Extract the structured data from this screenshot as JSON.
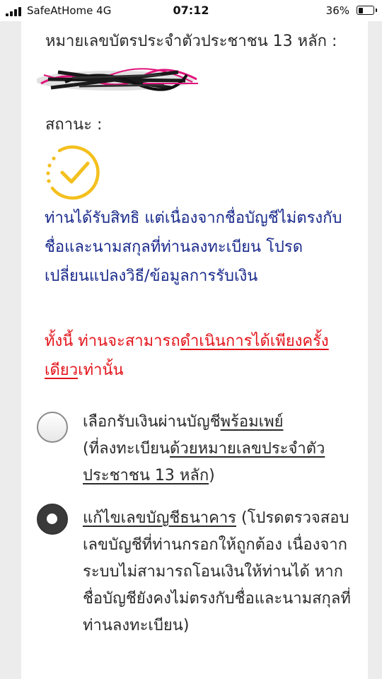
{
  "status_bar": {
    "carrier": "SafeAtHome  4G",
    "time": "07:12",
    "battery_percent_label": "36%",
    "battery_level": 0.36
  },
  "id_field": {
    "label": "หมายเลขบัตรประจำตัวประชาชน 13 หลัก :"
  },
  "status": {
    "label": "สถานะ :",
    "icon": "check-circle-icon",
    "icon_color": "#f4c01e"
  },
  "message": {
    "blue_text": "ท่านได้รับสิทธิ แต่เนื่องจากชื่อบัญชีไม่ตรงกับชื่อและนามสกุลที่ท่านลงทะเบียน โปรดเปลี่ยนแปลงวิธี/ข้อมูลการรับเงิน",
    "blue_color": "#1a2a8c",
    "red_prefix": "ทั้งนี้ ท่านจะสามารถ",
    "red_underlined": "ดำเนินการได้เพียงครั้งเดียว",
    "red_suffix": "เท่านั้น",
    "red_color": "#e3141b"
  },
  "options": [
    {
      "selected": false,
      "part1": "เลือกรับเงินผ่านบัญชี",
      "part1_u": "พร้อมเพย์",
      "part2": "(ที่ลงทะเบียน",
      "part2_u": "ด้วยหมายเลขประจำตัวประชาชน 13 หลัก",
      "part3": ")"
    },
    {
      "selected": true,
      "part1_u": "แก้ไขเลขบัญชีธนาคาร",
      "part2": " (โปรดตรวจสอบเลขบัญชีที่ท่านกรอกให้ถูกต้อง เนื่องจากระบบไม่สามารถโอนเงินให้ท่านได้ หากชื่อบัญชียังคงไม่ตรงกับชื่อและนามสกุลที่ท่านลงทะเบียน)"
    }
  ]
}
